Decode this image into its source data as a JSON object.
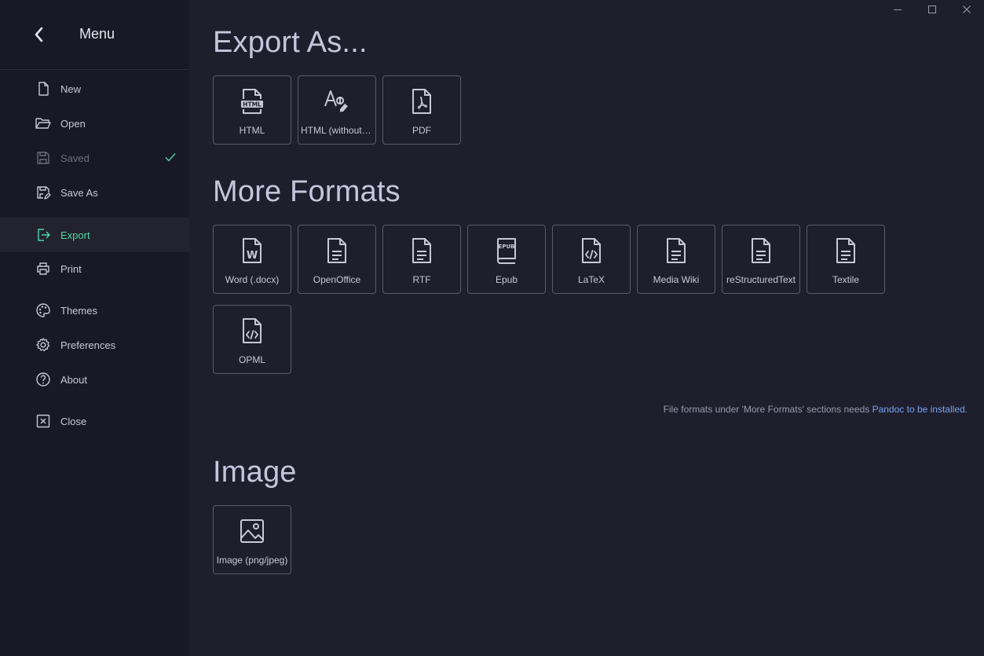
{
  "sidebar": {
    "title": "Menu",
    "items": [
      {
        "label": "New",
        "icon": "file-icon"
      },
      {
        "label": "Open",
        "icon": "folder-open-icon"
      },
      {
        "label": "Saved",
        "icon": "save-icon",
        "state": "disabled"
      },
      {
        "label": "Save As",
        "icon": "save-as-icon"
      },
      {
        "label": "Export",
        "icon": "export-icon",
        "state": "active"
      },
      {
        "label": "Print",
        "icon": "printer-icon"
      },
      {
        "label": "Themes",
        "icon": "palette-icon"
      },
      {
        "label": "Preferences",
        "icon": "gear-icon"
      },
      {
        "label": "About",
        "icon": "help-icon"
      },
      {
        "label": "Close",
        "icon": "close-box-icon"
      }
    ]
  },
  "sections": {
    "export_as": {
      "title": "Export As...",
      "tiles": [
        {
          "label": "HTML",
          "icon": "html-file-icon"
        },
        {
          "label": "HTML (without styles)",
          "icon": "font-style-icon"
        },
        {
          "label": "PDF",
          "icon": "pdf-file-icon"
        }
      ]
    },
    "more_formats": {
      "title": "More Formats",
      "tiles": [
        {
          "label": "Word (.docx)",
          "icon": "word-file-icon"
        },
        {
          "label": "OpenOffice",
          "icon": "document-icon"
        },
        {
          "label": "RTF",
          "icon": "document-icon"
        },
        {
          "label": "Epub",
          "icon": "epub-book-icon"
        },
        {
          "label": "LaTeX",
          "icon": "code-file-icon"
        },
        {
          "label": "Media Wiki",
          "icon": "document-icon"
        },
        {
          "label": "reStructuredText",
          "icon": "document-icon"
        },
        {
          "label": "Textile",
          "icon": "document-icon"
        },
        {
          "label": "OPML",
          "icon": "code-file-icon"
        }
      ],
      "note_text": "File formats under 'More Formats' sections needs ",
      "note_link": "Pandoc to be installed."
    },
    "image": {
      "title": "Image",
      "tiles": [
        {
          "label": "Image (png/jpeg)",
          "icon": "image-icon"
        }
      ]
    }
  },
  "colors": {
    "background": "#1e1e2d",
    "sidebar": "#191926",
    "accent": "#4fd6a5",
    "link": "#7aa4ef",
    "tile_border": "#5a5a6e"
  }
}
